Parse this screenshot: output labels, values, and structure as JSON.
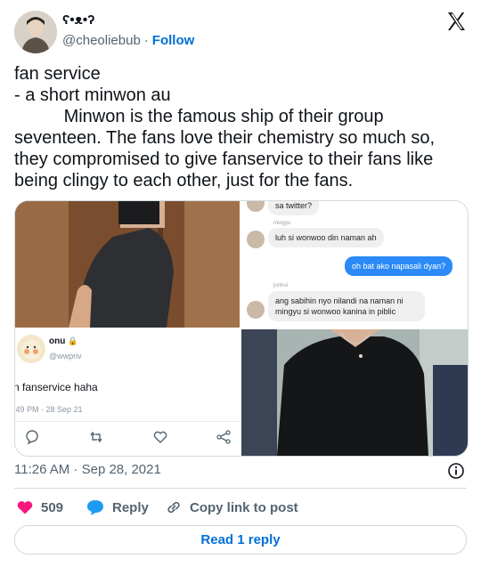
{
  "author": {
    "display_name": "ʕ•ᴥ•ʔ",
    "handle": "@cheoliebub",
    "separator": "·",
    "follow_label": "Follow"
  },
  "tweet": {
    "text": "fan service\n- a short minwon au\n          Minwon is the famous ship of their group seventeen. The fans love their chemistry so much so, they compromised to give fanservice to their fans like being clingy to each other, just for the fans."
  },
  "media": {
    "chat": {
      "msg0": "sa twitter?",
      "sender1": "mingyu",
      "msg1": "luh si wonwoo din naman ah",
      "msg2": "oh bat ako napasali dyan?",
      "sender3": "junhui",
      "msg3": "ang sabihin nyo nilandi na naman ni mingyu si wonwoo kanina in piblic"
    },
    "quoted": {
      "name": "onu",
      "handle": "@wwpriv",
      "text": "n fanservice haha",
      "time": ":49 PM · 28 Sep 21"
    }
  },
  "meta": {
    "timestamp": "11:26 AM · Sep 28, 2021"
  },
  "actions": {
    "likes": "509",
    "reply_label": "Reply",
    "copy_label": "Copy link to post"
  },
  "read_reply_label": "Read 1 reply"
}
